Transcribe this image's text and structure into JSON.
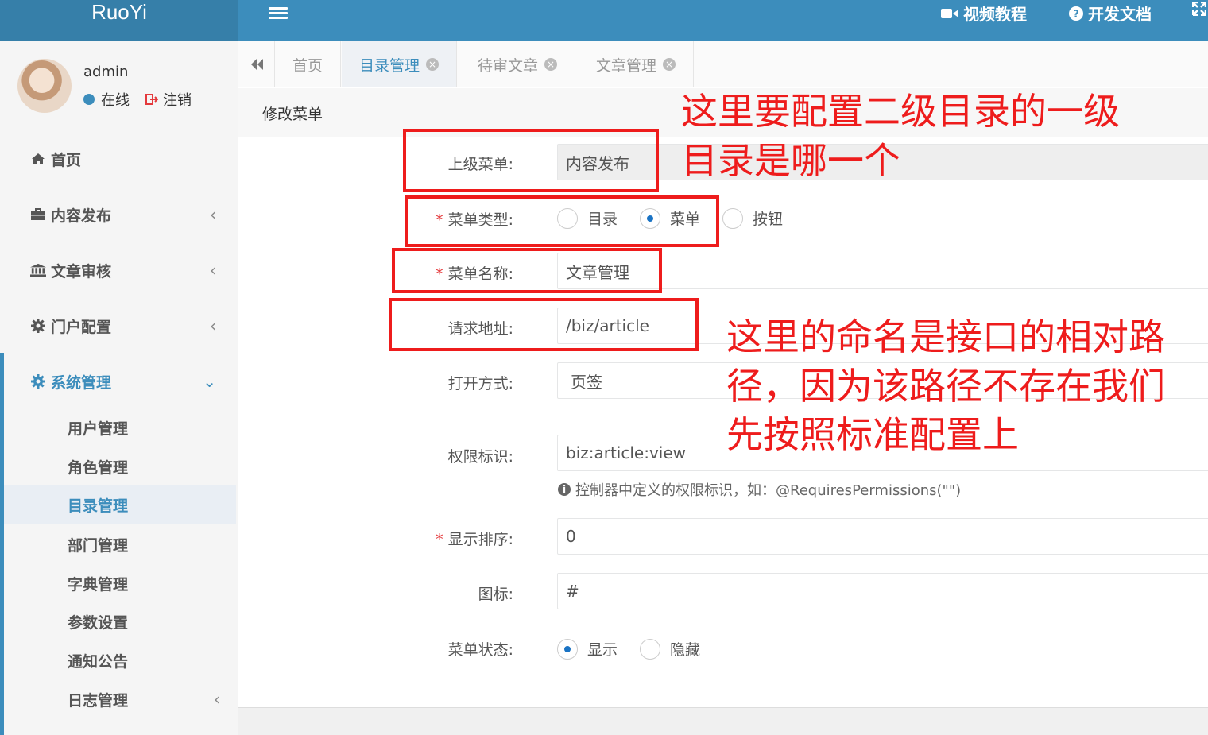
{
  "app": {
    "logo": "RuoYi"
  },
  "topbar": {
    "video_tutorial": "视频教程",
    "dev_docs": "开发文档"
  },
  "user": {
    "name": "admin",
    "status": "在线",
    "logout": "注销"
  },
  "sidebar": {
    "items": [
      {
        "label": "首页",
        "icon": "home-icon"
      },
      {
        "label": "内容发布",
        "icon": "briefcase-icon"
      },
      {
        "label": "文章审核",
        "icon": "bank-icon"
      },
      {
        "label": "门户配置",
        "icon": "gear-icon"
      },
      {
        "label": "系统管理",
        "icon": "gear-icon"
      }
    ],
    "subitems": [
      {
        "label": "用户管理"
      },
      {
        "label": "角色管理"
      },
      {
        "label": "目录管理"
      },
      {
        "label": "部门管理"
      },
      {
        "label": "字典管理"
      },
      {
        "label": "参数设置"
      },
      {
        "label": "通知公告"
      },
      {
        "label": "日志管理"
      }
    ]
  },
  "tabs": [
    {
      "label": "首页"
    },
    {
      "label": "目录管理"
    },
    {
      "label": "待审文章"
    },
    {
      "label": "文章管理"
    }
  ],
  "panel": {
    "title": "修改菜单"
  },
  "form": {
    "parent_menu": {
      "label": "上级菜单:",
      "value": "内容发布"
    },
    "menu_type": {
      "label": "菜单类型:",
      "options": [
        "目录",
        "菜单",
        "按钮"
      ],
      "selected": "菜单"
    },
    "menu_name": {
      "label": "菜单名称:",
      "value": "文章管理"
    },
    "request_url": {
      "label": "请求地址:",
      "value": "/biz/article"
    },
    "open_mode": {
      "label": "打开方式:",
      "value": "页签"
    },
    "perms": {
      "label": "权限标识:",
      "value": "biz:article:view",
      "help": "控制器中定义的权限标识，如：@RequiresPermissions(\"\")"
    },
    "order": {
      "label": "显示排序:",
      "value": "0"
    },
    "icon": {
      "label": "图标:",
      "value": "#"
    },
    "visible": {
      "label": "菜单状态:",
      "options": [
        "显示",
        "隐藏"
      ],
      "selected": "显示"
    }
  },
  "annotations": {
    "note1_line1": "这里要配置二级目录的一级",
    "note1_line2": "目录是哪一个",
    "note2_line1": "这里的命名是接口的相对路",
    "note2_line2": "径，因为该路径不存在我们",
    "note2_line3": "先按照标准配置上",
    "color": "#ee1c1c"
  },
  "colors": {
    "primary": "#3c8dbc",
    "logo_bg": "#367fa9",
    "sidebar_bg": "#f5f5f5"
  }
}
